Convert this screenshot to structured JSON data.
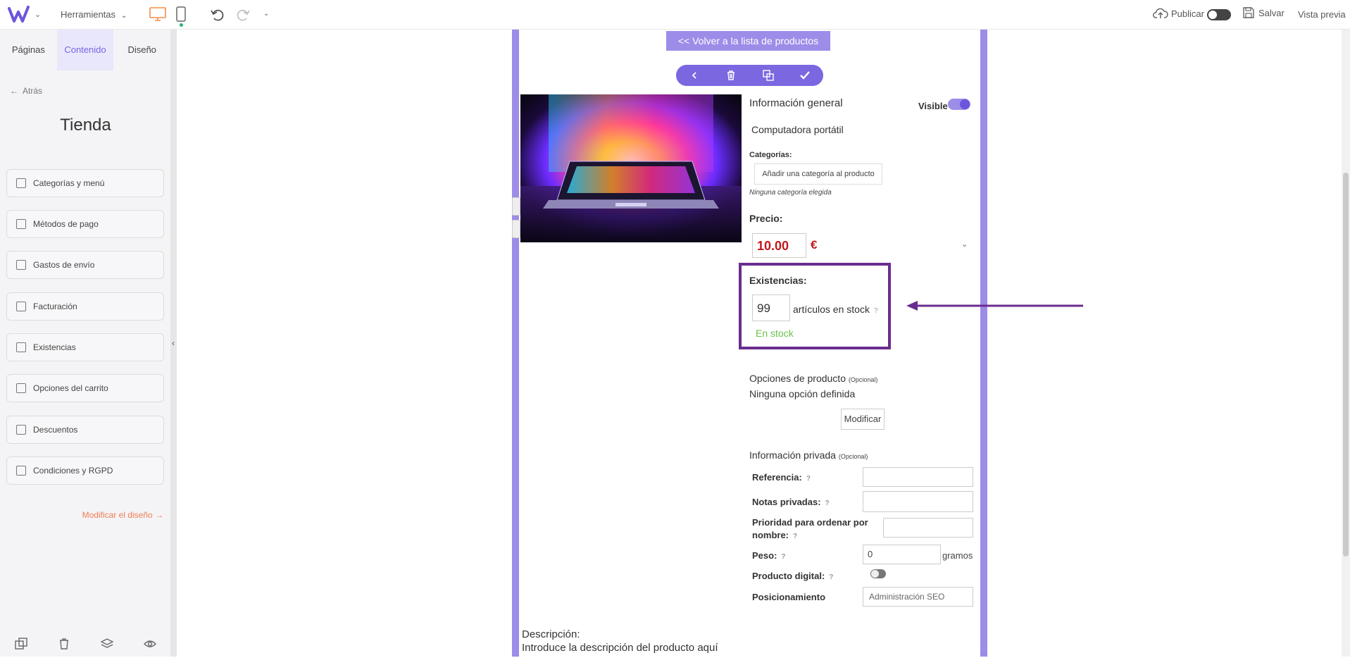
{
  "header": {
    "tools_label": "Herramientas",
    "publish_label": "Publicar",
    "save_label": "Salvar",
    "preview_label": "Vista previa",
    "brand_color": "#6a56dd",
    "accent_color": "#f58c4b"
  },
  "sidebar": {
    "tabs": [
      {
        "label": "Páginas",
        "active": false
      },
      {
        "label": "Contenido",
        "active": true
      },
      {
        "label": "Diseño",
        "active": false
      }
    ],
    "back_label": "Atrás",
    "title": "Tienda",
    "items": [
      {
        "label": "Categorías y menú",
        "icon": "folder-icon"
      },
      {
        "label": "Métodos de pago",
        "icon": "credit-card-icon"
      },
      {
        "label": "Gastos de envío",
        "icon": "truck-icon"
      },
      {
        "label": "Facturación",
        "icon": "clipboard-icon"
      },
      {
        "label": "Existencias",
        "icon": "inventory-icon"
      },
      {
        "label": "Opciones del carrito",
        "icon": "grid-icon"
      },
      {
        "label": "Descuentos",
        "icon": "tag-icon"
      },
      {
        "label": "Condiciones y RGPD",
        "icon": "document-icon"
      }
    ],
    "modify_design_label": "Modificar el diseño"
  },
  "product": {
    "back_to_list": "<< Volver a la lista de productos",
    "general_info": "Información general",
    "visible_label": "Visible",
    "visible": true,
    "name": "Computadora portátil",
    "categories_label": "Categorías:",
    "add_category": "Añadir una categoría al producto",
    "no_category": "Ninguna categoría elegida",
    "price_label": "Precio:",
    "price_value": "10.00",
    "currency": "€",
    "stock_label": "Existencias:",
    "stock_value": "99",
    "stock_unit": "artículos en stock",
    "stock_status": "En stock",
    "options_label": "Opciones de producto",
    "optional": "(Opcional)",
    "no_options": "Ninguna opción definida",
    "modify_label": "Modificar",
    "private_info": "Información privada",
    "reference_label": "Referencia:",
    "reference_value": "",
    "private_notes_label": "Notas privadas:",
    "private_notes_value": "",
    "priority_label": "Prioridad para ordenar por nombre:",
    "priority_value": "",
    "weight_label": "Peso:",
    "weight_value": "0",
    "weight_unit": "gramos",
    "digital_label": "Producto digital:",
    "digital": false,
    "seo_label": "Posicionamiento",
    "seo_button": "Administración SEO",
    "description_label": "Descripción:",
    "description_placeholder": "Introduce la descripción del producto aquí",
    "help_mark": "?"
  },
  "annotation": {
    "highlight_color": "#6a2d8f"
  }
}
